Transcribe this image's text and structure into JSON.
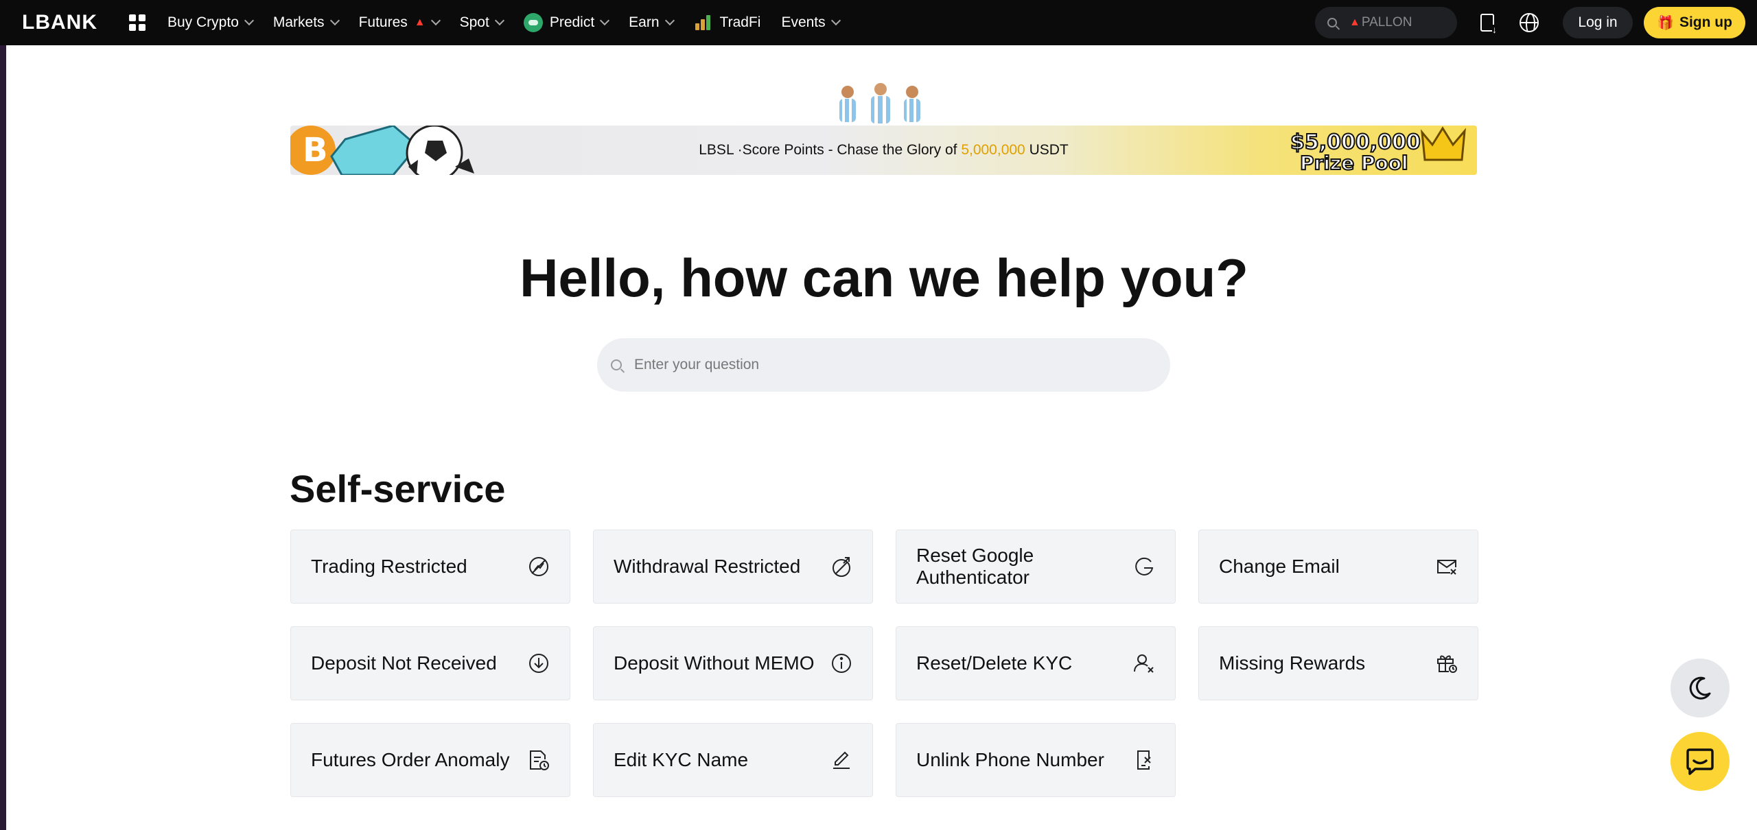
{
  "nav": {
    "logo": "LBANK",
    "items": [
      {
        "label": "Buy Crypto"
      },
      {
        "label": "Markets"
      },
      {
        "label": "Futures"
      },
      {
        "label": "Spot"
      },
      {
        "label": "Predict"
      },
      {
        "label": "Earn"
      },
      {
        "label": "TradFi"
      },
      {
        "label": "Events"
      }
    ],
    "search_placeholder": "PALLON",
    "login_label": "Log in",
    "signup_label": "Sign up"
  },
  "banner": {
    "text_prefix": "LBSL ·Score Points - Chase the Glory of ",
    "highlight": "5,000,000",
    "text_suffix": " USDT",
    "prize_line1": "$5,000,000",
    "prize_line2": "Prize Pool",
    "accent_color": "#e0a100"
  },
  "hero": {
    "title": "Hello, how can we help you?",
    "search_placeholder": "Enter your question"
  },
  "self_service": {
    "title": "Self-service",
    "cards": [
      {
        "label": "Trading Restricted",
        "icon": "trading-restricted-icon"
      },
      {
        "label": "Withdrawal Restricted",
        "icon": "withdrawal-restricted-icon"
      },
      {
        "label": "Reset Google Authenticator",
        "icon": "google-icon"
      },
      {
        "label": "Change Email",
        "icon": "email-icon"
      },
      {
        "label": "Deposit Not Received",
        "icon": "download-circle-icon"
      },
      {
        "label": "Deposit Without MEMO",
        "icon": "info-circle-icon"
      },
      {
        "label": "Reset/Delete KYC",
        "icon": "user-remove-icon"
      },
      {
        "label": "Missing Rewards",
        "icon": "gift-icon"
      },
      {
        "label": "Futures Order Anomaly",
        "icon": "document-clock-icon"
      },
      {
        "label": "Edit KYC Name",
        "icon": "edit-icon"
      },
      {
        "label": "Unlink Phone Number",
        "icon": "phone-unlink-icon"
      }
    ]
  },
  "colors": {
    "brand_yellow": "#fcd535",
    "nav_bg": "#0b0b0c",
    "card_bg": "#f3f4f6"
  }
}
